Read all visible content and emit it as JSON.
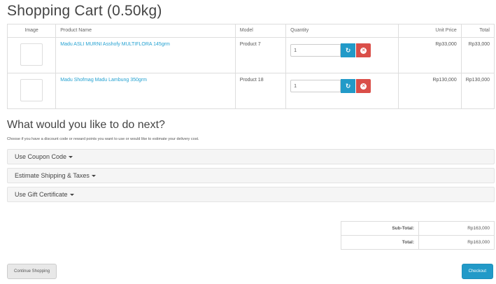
{
  "page": {
    "title": "Shopping Cart  (0.50kg)"
  },
  "cart": {
    "headers": {
      "image": "Image",
      "name": "Product Name",
      "model": "Model",
      "quantity": "Quantity",
      "unit_price": "Unit Price",
      "total": "Total"
    },
    "items": [
      {
        "name": "Madu ASLI MURNI Asshofy MULTIFLORA 145grm",
        "model": "Product 7",
        "quantity": "1",
        "unit_price": "Rp33,000",
        "total": "Rp33,000",
        "thumb": "honey-jar-thumbnail"
      },
      {
        "name": "Madu Shofmag Madu Lambung 350grm",
        "model": "Product 18",
        "quantity": "1",
        "unit_price": "Rp130,000",
        "total": "Rp130,000",
        "thumb": "honey-box-thumbnail"
      }
    ],
    "colors": {
      "link": "#23a1d1",
      "update": "#229ac8",
      "remove": "#da4f49"
    }
  },
  "next": {
    "heading": "What would you like to do next?",
    "help": "Choose if you have a discount code or reward points you want to use or would like to estimate your delivery cost.",
    "panels": [
      {
        "label": "Use Coupon Code"
      },
      {
        "label": "Estimate Shipping & Taxes"
      },
      {
        "label": "Use Gift Certificate"
      }
    ]
  },
  "totals": [
    {
      "label": "Sub-Total:",
      "value": "Rp163,000"
    },
    {
      "label": "Total:",
      "value": "Rp163,000"
    }
  ],
  "buttons": {
    "continue": "Continue Shopping",
    "checkout": "Checkout"
  }
}
